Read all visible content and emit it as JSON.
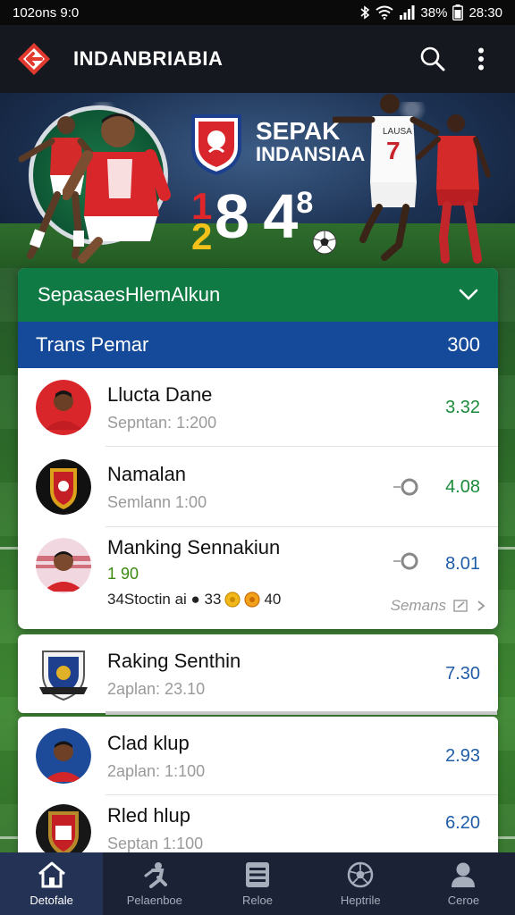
{
  "status_bar": {
    "time_left": "102ons 9:0",
    "battery": "38%",
    "time_right": "28:30"
  },
  "app_bar": {
    "title": "INDANBRIABIA"
  },
  "hero": {
    "title_line1": "SEPAK",
    "title_line2": "INDANSIAA",
    "score_small_top": "1",
    "score_small_bottom": "2",
    "score": "8 4",
    "score_sup": "8",
    "jersey_number": "7",
    "jersey_name": "LAUSA"
  },
  "panel": {
    "header": "SepasaesHlemAlkun",
    "subheader_label": "Trans Pemar",
    "subheader_value": "300",
    "rows": [
      {
        "name": "Llucta Dane",
        "sub": "Sepntan: 1:200",
        "value": "3.32"
      },
      {
        "name": "Namalan",
        "sub": "Semlann 1:00",
        "value": "4.08"
      },
      {
        "name": "Manking Sennakiun",
        "highlight": "1 90",
        "stats": "34Stoctin ai ● 33",
        "stats_coins": "40",
        "value": "8.01",
        "link": "Semans"
      }
    ]
  },
  "cards": [
    {
      "name": "Raking Senthin",
      "sub": "2aplan: 23.10",
      "value": "7.30"
    },
    {
      "name": "Clad klup",
      "sub": "2aplan: 1:100",
      "value": "2.93"
    },
    {
      "name": "Rled hlup",
      "sub": "Septan 1:100",
      "value": "6.20"
    }
  ],
  "bottom_nav": [
    {
      "label": "Detofale",
      "icon": "home-icon"
    },
    {
      "label": "Pelaenboe",
      "icon": "player-icon"
    },
    {
      "label": "Reloe",
      "icon": "list-icon"
    },
    {
      "label": "Heptrile",
      "icon": "ball-icon"
    },
    {
      "label": "Ceroe",
      "icon": "profile-icon"
    }
  ],
  "colors": {
    "app_bar": "#15181f",
    "panel_header": "#0f7a44",
    "panel_subheader": "#154a9a",
    "value_green": "#1a8a3a",
    "value_blue": "#1f5ca8",
    "bottom_nav": "#1b2236"
  }
}
